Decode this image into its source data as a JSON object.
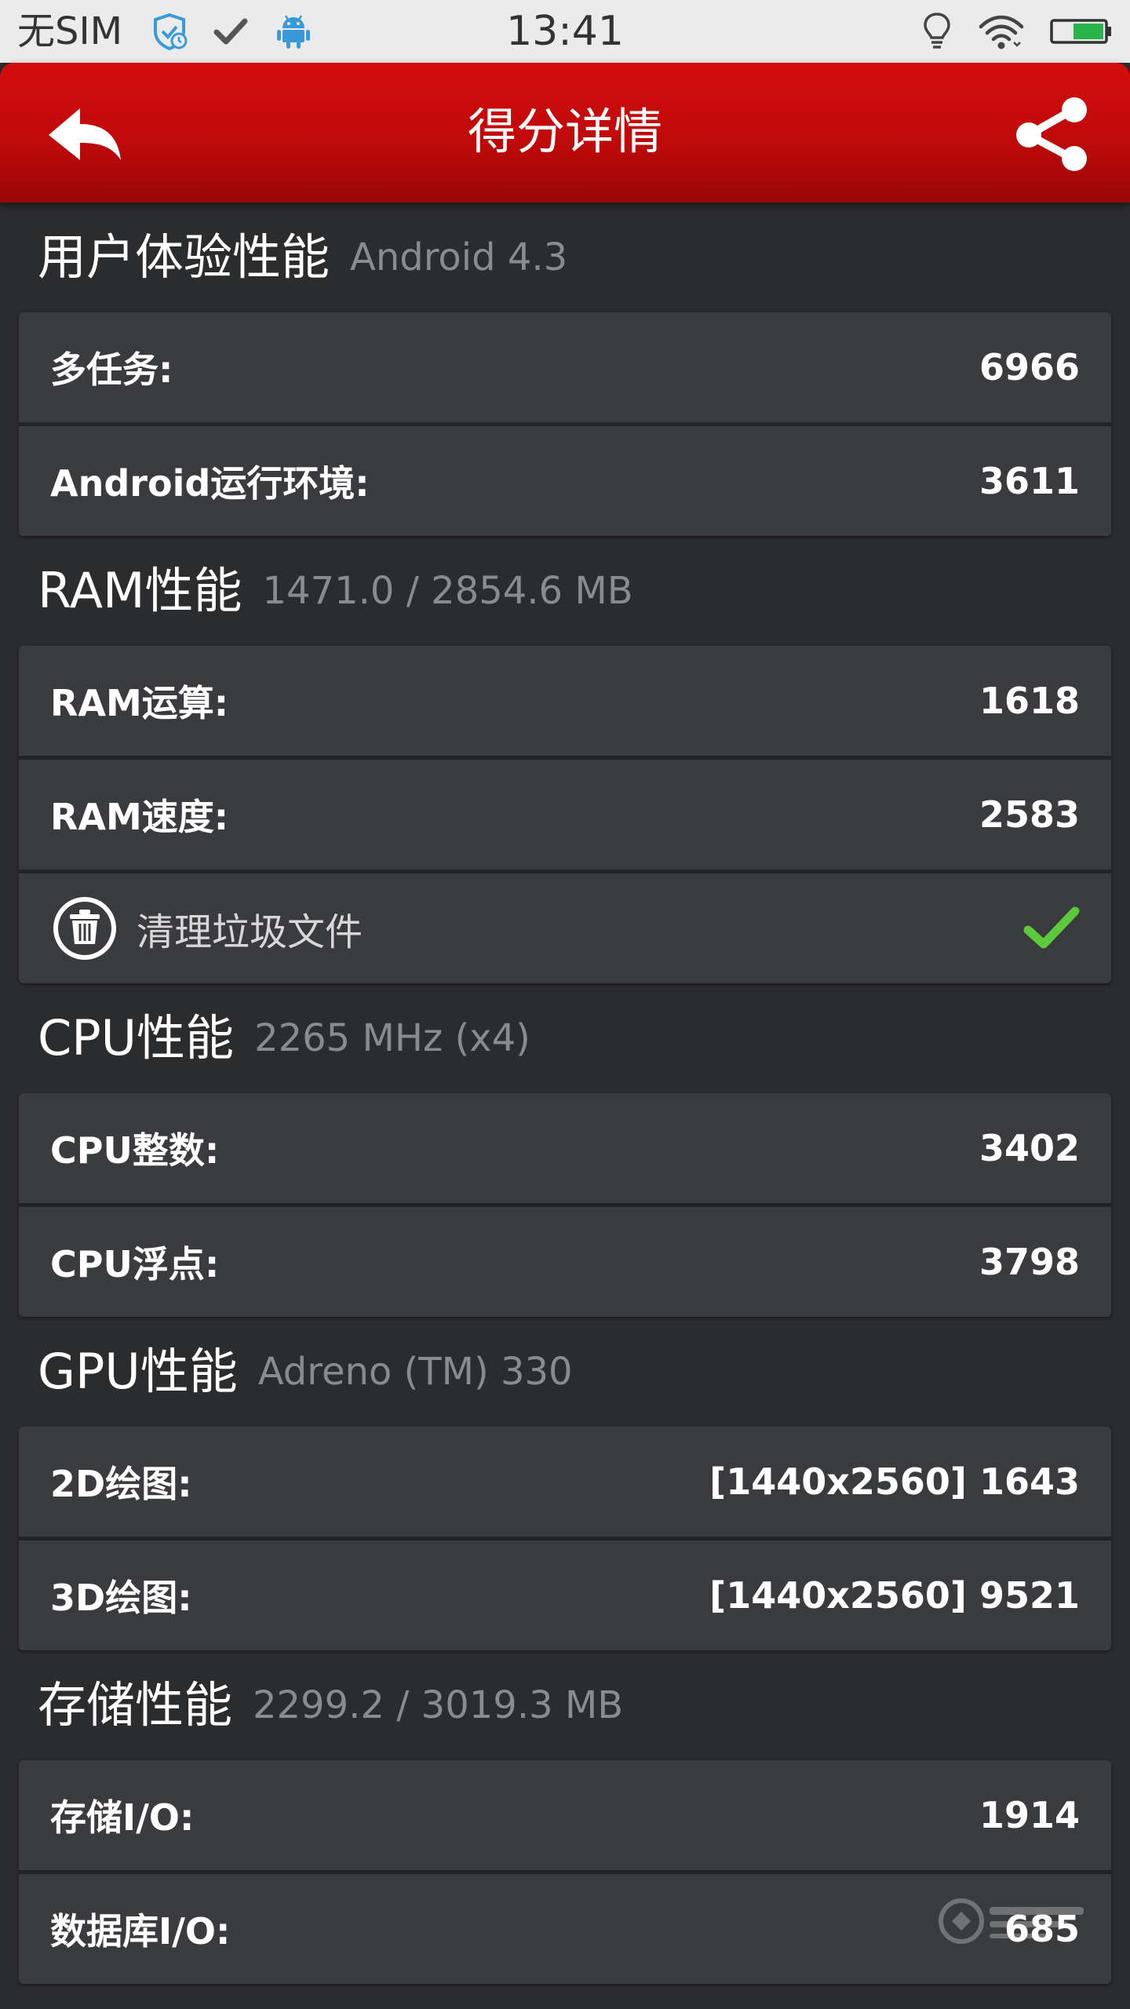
{
  "status_bar": {
    "carrier": "无SIM",
    "time": "13:41"
  },
  "header": {
    "title": "得分详情"
  },
  "sections": [
    {
      "title": "用户体验性能",
      "subtitle": "Android 4.3",
      "rows": [
        {
          "label": "多任务:",
          "value": "6966"
        },
        {
          "label": "Android运行环境:",
          "value": "3611"
        }
      ]
    },
    {
      "title": "RAM性能",
      "subtitle": "1471.0 / 2854.6 MB",
      "rows": [
        {
          "label": "RAM运算:",
          "value": "1618"
        },
        {
          "label": "RAM速度:",
          "value": "2583"
        }
      ],
      "action": {
        "label": "清理垃圾文件"
      }
    },
    {
      "title": "CPU性能",
      "subtitle": "2265 MHz (x4)",
      "rows": [
        {
          "label": "CPU整数:",
          "value": "3402"
        },
        {
          "label": "CPU浮点:",
          "value": "3798"
        }
      ]
    },
    {
      "title": "GPU性能",
      "subtitle": "Adreno (TM) 330",
      "rows": [
        {
          "label": "2D绘图:",
          "value": "[1440x2560] 1643"
        },
        {
          "label": "3D绘图:",
          "value": "[1440x2560] 9521"
        }
      ]
    },
    {
      "title": "存储性能",
      "subtitle": "2299.2 / 3019.3 MB",
      "rows": [
        {
          "label": "存储I/O:",
          "value": "1914"
        },
        {
          "label": "数据库I/O:",
          "value": "685"
        }
      ]
    }
  ],
  "colors": {
    "header_red": "#c00a0a",
    "background": "#2b2c2e",
    "card": "#3a3b3e",
    "check_green": "#5cc93a"
  }
}
